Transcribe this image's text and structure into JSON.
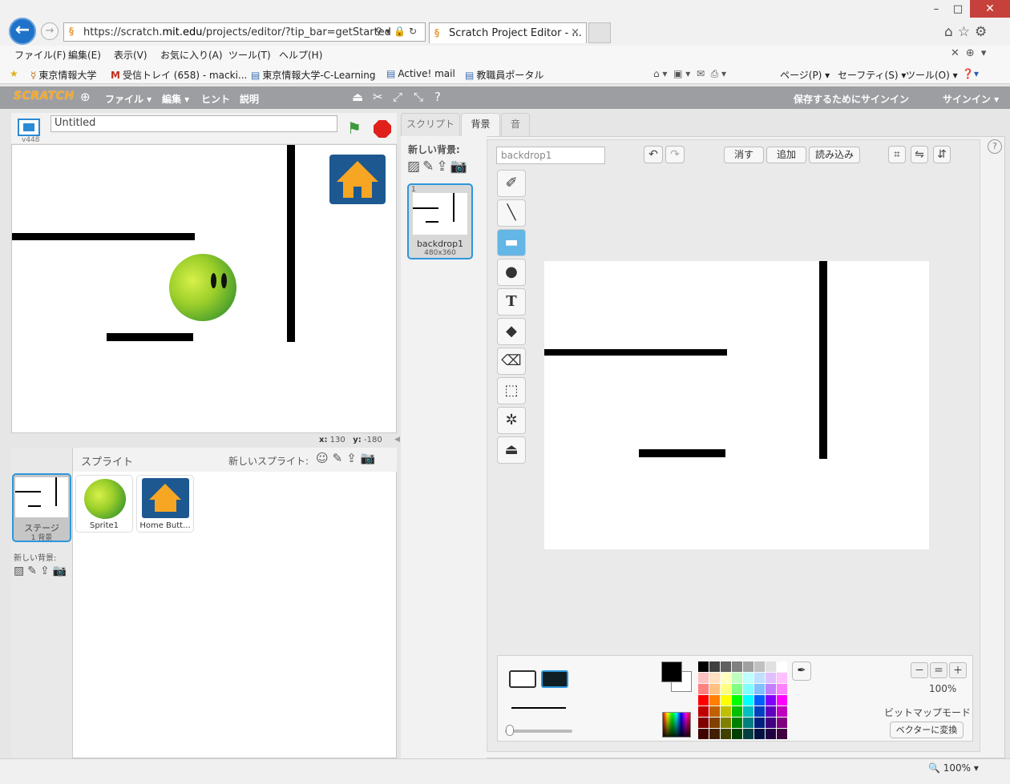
{
  "browser": {
    "url_prefix": "https://scratch.",
    "url_domain": "mit.edu",
    "url_path": "/projects/editor/?tip_bar=getStarted",
    "tab_title": "Scratch Project Editor - ...",
    "tab_close": "×",
    "window_controls": [
      "–",
      "□",
      "✕"
    ],
    "menu": [
      "ファイル(F)",
      "編集(E)",
      "表示(V)",
      "お気に入り(A)",
      "ツール(T)",
      "ヘルプ(H)"
    ],
    "favorites": [
      "東京情報大学",
      "受信トレイ (658) - macki...",
      "東京情報大学-C-Learning",
      "Active! mail",
      "教職員ポータル"
    ],
    "commands": [
      "ページ(P) ▾",
      "セーフティ(S) ▾",
      "ツール(O) ▾"
    ],
    "status_zoom": "🔍 100%  ▾"
  },
  "scratch": {
    "logo": "SCRATCH",
    "menu": [
      "ファイル ▾",
      "編集 ▾",
      "ヒント",
      "説明"
    ],
    "save_prompt": "保存するためにサインイン",
    "signin": "サインイン ▾"
  },
  "stage": {
    "version": "v448",
    "project_title": "Untitled",
    "coords_x_label": "x:",
    "coords_x": "130",
    "coords_y_label": "y:",
    "coords_y": "-180"
  },
  "sprites": {
    "title": "スプライト",
    "new_sprite": "新しいスプライト:",
    "stage_label": "ステージ",
    "stage_sub": "1 背景",
    "stage_newbg": "新しい背景:",
    "items": [
      {
        "name": "Sprite1"
      },
      {
        "name": "Home Butt..."
      }
    ]
  },
  "editor": {
    "tabs": [
      "スクリプト",
      "背景",
      "音"
    ],
    "active_tab": 1,
    "new_backdrop": "新しい背景:",
    "backdrop": {
      "index": "1",
      "name": "backdrop1",
      "size": "480x360"
    },
    "costume_name_value": "backdrop1",
    "buttons": {
      "clear": "消す",
      "add": "追加",
      "import": "読み込み"
    },
    "zoom": "100%",
    "mode_label": "ビットマップモード",
    "convert_label": "ベクターに変換"
  },
  "palette_colors": [
    "#000000",
    "#404040",
    "#606060",
    "#808080",
    "#a0a0a0",
    "#c0c0c0",
    "#e0e0e0",
    "#ffffff",
    "#ffc0c0",
    "#ffe0c0",
    "#ffffc0",
    "#c0ffc0",
    "#c0ffff",
    "#c0e0ff",
    "#e0c0ff",
    "#ffc0ff",
    "#ff8080",
    "#ffc080",
    "#ffff80",
    "#80ff80",
    "#80ffff",
    "#80c0ff",
    "#c080ff",
    "#ff80ff",
    "#ff0000",
    "#ff8000",
    "#ffff00",
    "#00ff00",
    "#00ffff",
    "#0060ff",
    "#8000ff",
    "#ff00ff",
    "#c00000",
    "#c06000",
    "#c0c000",
    "#00c000",
    "#00c0c0",
    "#0040c0",
    "#6000c0",
    "#c000c0",
    "#800000",
    "#804000",
    "#808000",
    "#008000",
    "#008080",
    "#002080",
    "#400080",
    "#800080",
    "#400000",
    "#402000",
    "#404000",
    "#004000",
    "#004040",
    "#001040",
    "#200040",
    "#400040"
  ]
}
